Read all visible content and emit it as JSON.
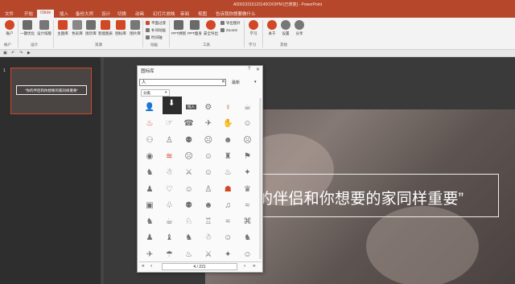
{
  "window": {
    "title": "A00023315123140OXOPM [已修复] - PowerPoint"
  },
  "tabs": [
    {
      "label": "文件"
    },
    {
      "label": "开始"
    },
    {
      "label": "iSlide",
      "active": true
    },
    {
      "label": "插入"
    },
    {
      "label": "备份大师"
    },
    {
      "label": "设计"
    },
    {
      "label": "切换"
    },
    {
      "label": "动画"
    },
    {
      "label": "幻灯片放映"
    },
    {
      "label": "审阅"
    },
    {
      "label": "视图"
    },
    {
      "label": "告诉我你想要做什么"
    }
  ],
  "ribbon": {
    "account": "账户",
    "optimize": "一键优化",
    "design_tools": "设计排版",
    "theme_lib": "主题库",
    "color_lib": "色彩库",
    "chart_lib": "图示库",
    "smart_chart": "智能图表",
    "icon_lib": "图标库",
    "image_lib": "图片库",
    "smart_tools": [
      "平面过渡",
      "补间动画",
      "时间轴"
    ],
    "ppt_thumb": "PPT拼图",
    "ppt_slim": "PPT瘦身",
    "safe_export": "安全导出",
    "other_tools": [
      "导出图片",
      "Zoomit"
    ],
    "learn": "学习",
    "about": "关于",
    "settings": "设置",
    "share": "分享",
    "groups": [
      "帐户",
      "设计",
      "资源",
      "动画",
      "工具",
      "学习",
      "其他"
    ]
  },
  "slide_panel": {
    "slide_number": "1",
    "thumb_text": "“你的伴侣和你想要的家同样重要”"
  },
  "slide": {
    "quote": "的伴侣和你想要的家同样重要”"
  },
  "icon_library": {
    "title": "图标库",
    "search_value": "人",
    "sort_label": "最新",
    "category_label": "分类",
    "hover_label": "插入",
    "page_indicator": "4 / 221",
    "icons": [
      "👤",
      "⬇",
      "",
      "⚙",
      "♀",
      "☕",
      "♨",
      "☞",
      "☎",
      "✈",
      "✋",
      "☺",
      "⚇",
      "♙",
      "⚉",
      "☹",
      "☻",
      "☹",
      "◉",
      "≋",
      "☹",
      "☺",
      "♜",
      "⚑",
      "♞",
      "☃",
      "⚔",
      "☺",
      "♨",
      "✦",
      "♟",
      "♡",
      "☺",
      "♙",
      "☗",
      "♛",
      "▣",
      "♧",
      "⚉",
      "☻",
      "♫",
      "≈",
      "♞",
      "☕",
      "♘",
      "♖",
      "≈",
      "⌘",
      "♟",
      "♝",
      "♞",
      "☃",
      "☺",
      "♞",
      "✈",
      "☂",
      "♨",
      "⚔",
      "✦",
      "☺"
    ],
    "red_icons": [
      4,
      6,
      19,
      34
    ]
  },
  "colors": {
    "accent": "#B7472A",
    "accent_dark": "#D24726"
  }
}
